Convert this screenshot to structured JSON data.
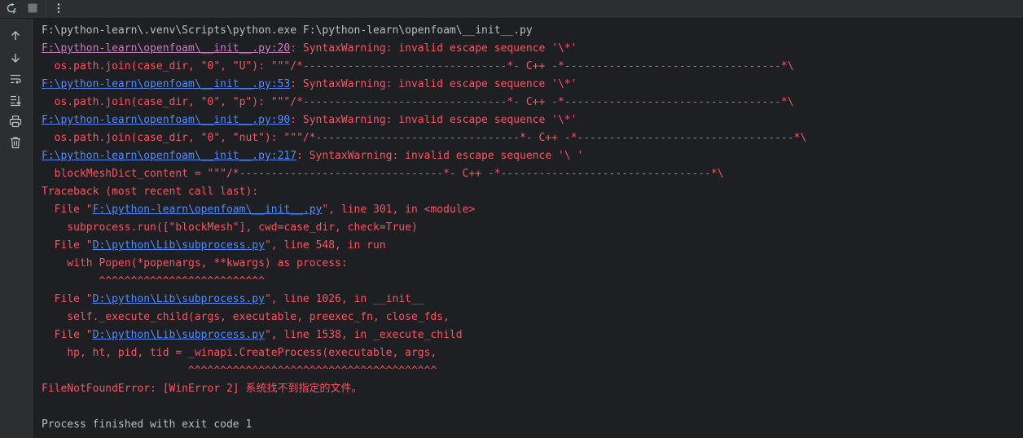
{
  "toolbar": {
    "rerun_icon": "rerun-icon",
    "stop_icon": "stop-icon",
    "more_icon": "more-vertical-icon"
  },
  "sidebar": {
    "icons": [
      "arrow-up-icon",
      "arrow-down-icon",
      "soft-wrap-icon",
      "scroll-to-end-icon",
      "print-icon",
      "trash-icon"
    ]
  },
  "colors": {
    "background": "#1e1f22",
    "panel": "#2b2d30",
    "error_text": "#f75464",
    "normal_text": "#bcbec4",
    "link_visited": "#c77dbb",
    "link": "#548af7"
  },
  "console": {
    "command": "F:\\python-learn\\.venv\\Scripts\\python.exe F:\\python-learn\\openfoam\\__init__.py",
    "w1_link": "F:\\python-learn\\openfoam\\__init__.py:20",
    "w1_msg": ": SyntaxWarning: invalid escape sequence '\\*'",
    "w1_code": "  os.path.join(case_dir, \"0\", \"U\"): \"\"\"/*--------------------------------*- C++ -*----------------------------------*\\",
    "w2_link": "F:\\python-learn\\openfoam\\__init__.py:53",
    "w2_msg": ": SyntaxWarning: invalid escape sequence '\\*'",
    "w2_code": "  os.path.join(case_dir, \"0\", \"p\"): \"\"\"/*--------------------------------*- C++ -*----------------------------------*\\",
    "w3_link": "F:\\python-learn\\openfoam\\__init__.py:90",
    "w3_msg": ": SyntaxWarning: invalid escape sequence '\\*'",
    "w3_code": "  os.path.join(case_dir, \"0\", \"nut\"): \"\"\"/*--------------------------------*- C++ -*----------------------------------*\\",
    "w4_link": "F:\\python-learn\\openfoam\\__init__.py:217",
    "w4_msg": ": SyntaxWarning: invalid escape sequence '\\ '",
    "w4_code": "  blockMeshDict_content = \"\"\"/*--------------------------------*- C++ -*---------------------------------*\\",
    "traceback_header": "Traceback (most recent call last):",
    "f1_pre": "  File \"",
    "f1_link": "F:\\python-learn\\openfoam\\__init__.py",
    "f1_post": "\", line 301, in <module>",
    "f1_code": "    subprocess.run([\"blockMesh\"], cwd=case_dir, check=True)",
    "f2_pre": "  File \"",
    "f2_link": "D:\\python\\Lib\\subprocess.py",
    "f2_post": "\", line 548, in run",
    "f2_code": "    with Popen(*popenargs, **kwargs) as process:",
    "f2_caret": "         ^^^^^^^^^^^^^^^^^^^^^^^^^^",
    "f3_pre": "  File \"",
    "f3_link": "D:\\python\\Lib\\subprocess.py",
    "f3_post": "\", line 1026, in __init__",
    "f3_code": "    self._execute_child(args, executable, preexec_fn, close_fds,",
    "f4_pre": "  File \"",
    "f4_link": "D:\\python\\Lib\\subprocess.py",
    "f4_post": "\", line 1538, in _execute_child",
    "f4_code": "    hp, ht, pid, tid = _winapi.CreateProcess(executable, args,",
    "f4_caret": "                       ^^^^^^^^^^^^^^^^^^^^^^^^^^^^^^^^^^^^^^^",
    "error": "FileNotFoundError: [WinError 2] 系统找不到指定的文件。",
    "exit": "Process finished with exit code 1"
  }
}
